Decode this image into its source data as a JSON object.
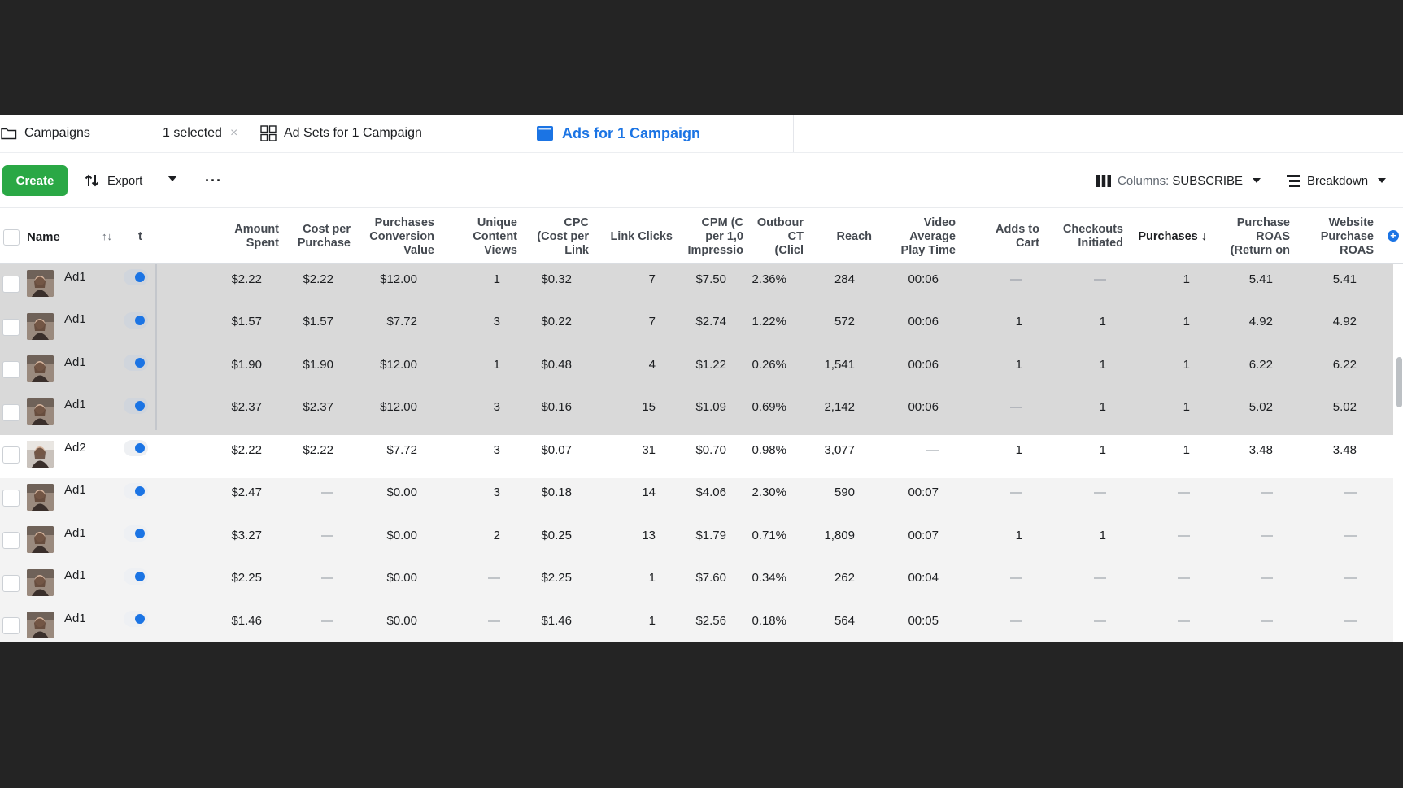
{
  "tabs": {
    "campaigns": "Campaigns",
    "selected": "1 selected",
    "close": "×",
    "ad_sets": "Ad Sets for 1 Campaign",
    "ads": "Ads for 1 Campaign"
  },
  "toolbar": {
    "create": "Create",
    "export": "Export",
    "more": "···",
    "columns_label": "Columns:",
    "columns_value": "SUBSCRIBE",
    "breakdown": "Breakdown"
  },
  "columns": {
    "name": "Name",
    "sort": "↑↓",
    "cut": "t",
    "amount_spent": "Amount\nSpent",
    "cost_per_purchase": "Cost per\nPurchase",
    "purchases_conversion_value": "Purchases\nConversion\nValue",
    "unique_content_views": "Unique\nContent\nViews",
    "cpc": "CPC\n(Cost per\nLink",
    "link_clicks": "Link Clicks",
    "cpm": "CPM (C\nper 1,0\nImpressio",
    "outbound_ctr": "Outbour\nCT\n(Clicl",
    "reach": "Reach",
    "video_avg_play_time": "Video\nAverage\nPlay Time",
    "adds_to_cart": "Adds to\nCart",
    "checkouts_initiated": "Checkouts\nInitiated",
    "purchases": "Purchases ↓",
    "purchase_roas": "Purchase\nROAS\n(Return on",
    "website_purchase_roas": "Website\nPurchase\nROAS"
  },
  "rows": [
    {
      "name": "Ad1",
      "amount": "$2.22",
      "cpp": "$2.22",
      "pcv": "$12.00",
      "ucv": "1",
      "cpc": "$0.32",
      "lc": "7",
      "cpm": "$7.50",
      "ctr": "2.36%",
      "reach": "284",
      "vapt": "00:06",
      "atc": "—",
      "ci": "—",
      "pur": "1",
      "roas": "5.41",
      "wroas": "5.41"
    },
    {
      "name": "Ad1",
      "amount": "$1.57",
      "cpp": "$1.57",
      "pcv": "$7.72",
      "ucv": "3",
      "cpc": "$0.22",
      "lc": "7",
      "cpm": "$2.74",
      "ctr": "1.22%",
      "reach": "572",
      "vapt": "00:06",
      "atc": "1",
      "ci": "1",
      "pur": "1",
      "roas": "4.92",
      "wroas": "4.92"
    },
    {
      "name": "Ad1",
      "amount": "$1.90",
      "cpp": "$1.90",
      "pcv": "$12.00",
      "ucv": "1",
      "cpc": "$0.48",
      "lc": "4",
      "cpm": "$1.22",
      "ctr": "0.26%",
      "reach": "1,541",
      "vapt": "00:06",
      "atc": "1",
      "ci": "1",
      "pur": "1",
      "roas": "6.22",
      "wroas": "6.22"
    },
    {
      "name": "Ad1",
      "amount": "$2.37",
      "cpp": "$2.37",
      "pcv": "$12.00",
      "ucv": "3",
      "cpc": "$0.16",
      "lc": "15",
      "cpm": "$1.09",
      "ctr": "0.69%",
      "reach": "2,142",
      "vapt": "00:06",
      "atc": "—",
      "ci": "1",
      "pur": "1",
      "roas": "5.02",
      "wroas": "5.02"
    },
    {
      "name": "Ad2",
      "amount": "$2.22",
      "cpp": "$2.22",
      "pcv": "$7.72",
      "ucv": "3",
      "cpc": "$0.07",
      "lc": "31",
      "cpm": "$0.70",
      "ctr": "0.98%",
      "reach": "3,077",
      "vapt": "—",
      "atc": "1",
      "ci": "1",
      "pur": "1",
      "roas": "3.48",
      "wroas": "3.48"
    },
    {
      "name": "Ad1",
      "amount": "$2.47",
      "cpp": "—",
      "pcv": "$0.00",
      "ucv": "3",
      "cpc": "$0.18",
      "lc": "14",
      "cpm": "$4.06",
      "ctr": "2.30%",
      "reach": "590",
      "vapt": "00:07",
      "atc": "—",
      "ci": "—",
      "pur": "—",
      "roas": "—",
      "wroas": "—"
    },
    {
      "name": "Ad1",
      "amount": "$3.27",
      "cpp": "—",
      "pcv": "$0.00",
      "ucv": "2",
      "cpc": "$0.25",
      "lc": "13",
      "cpm": "$1.79",
      "ctr": "0.71%",
      "reach": "1,809",
      "vapt": "00:07",
      "atc": "1",
      "ci": "1",
      "pur": "—",
      "roas": "—",
      "wroas": "—"
    },
    {
      "name": "Ad1",
      "amount": "$2.25",
      "cpp": "—",
      "pcv": "$0.00",
      "ucv": "—",
      "cpc": "$2.25",
      "lc": "1",
      "cpm": "$7.60",
      "ctr": "0.34%",
      "reach": "262",
      "vapt": "00:04",
      "atc": "—",
      "ci": "—",
      "pur": "—",
      "roas": "—",
      "wroas": "—"
    },
    {
      "name": "Ad1",
      "amount": "$1.46",
      "cpp": "—",
      "pcv": "$0.00",
      "ucv": "—",
      "cpc": "$1.46",
      "lc": "1",
      "cpm": "$2.56",
      "ctr": "0.18%",
      "reach": "564",
      "vapt": "00:05",
      "atc": "—",
      "ci": "—",
      "pur": "—",
      "roas": "—",
      "wroas": "—"
    }
  ],
  "colors": {
    "brand_blue": "#1b74e4",
    "create_green": "#2aa845",
    "selected_row": "#d9d9d9"
  }
}
